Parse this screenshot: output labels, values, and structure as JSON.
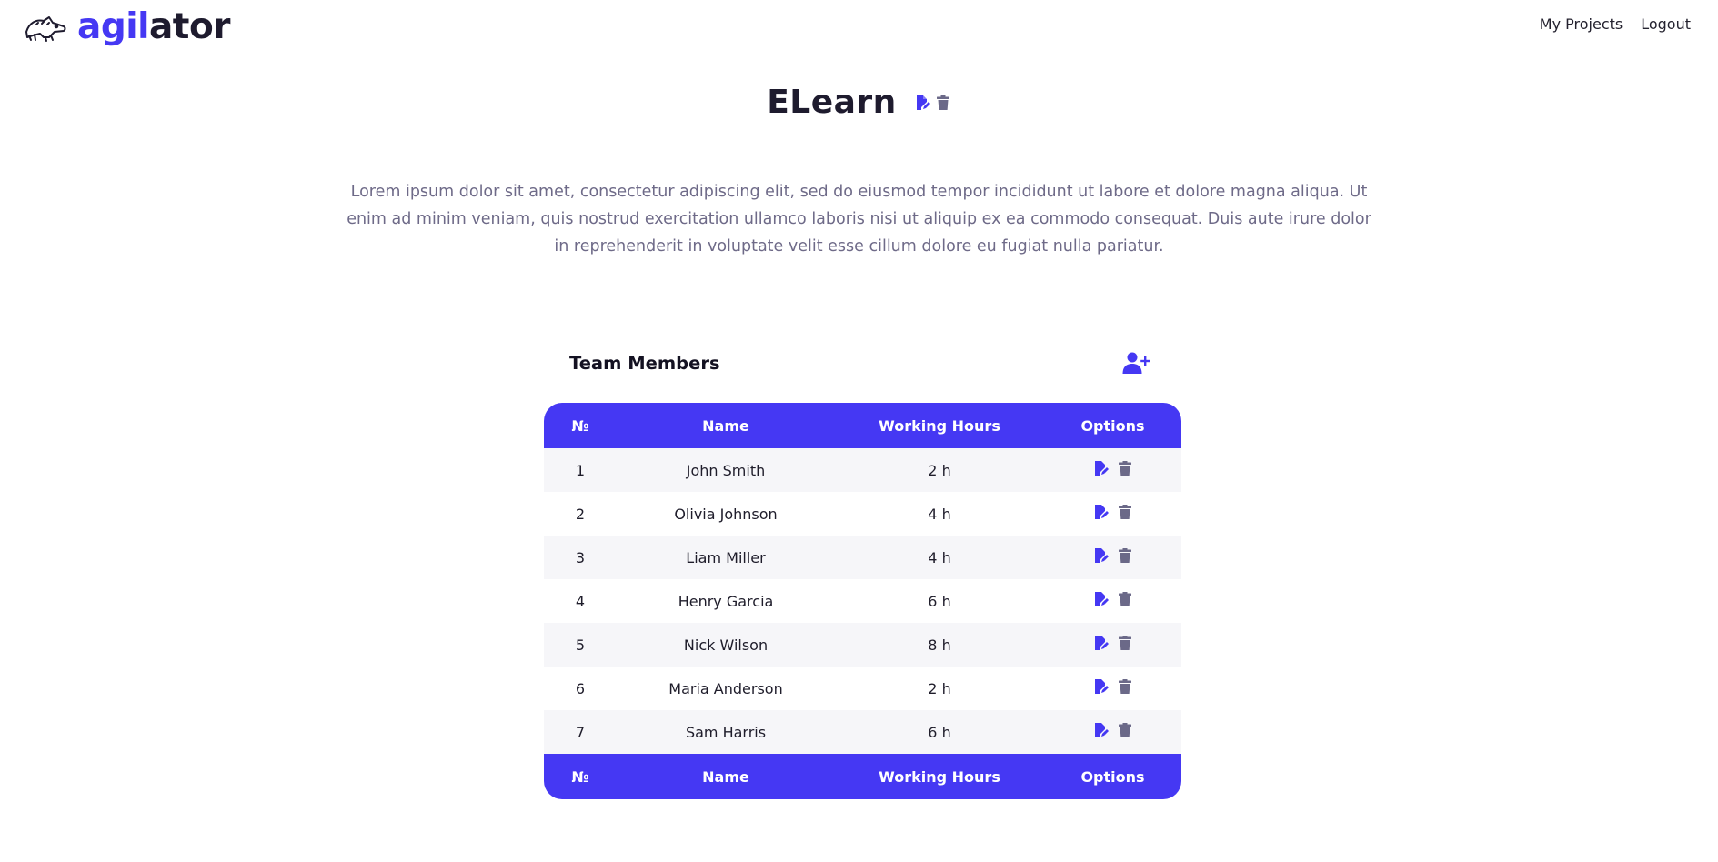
{
  "brand": {
    "accent_text": "agil",
    "rest_text": "ator",
    "icon": "crocodile-logo-icon"
  },
  "nav": {
    "my_projects": "My Projects",
    "logout": "Logout"
  },
  "project": {
    "title": "ELearn",
    "description": "Lorem ipsum dolor sit amet, consectetur adipiscing elit, sed do eiusmod tempor incididunt ut labore et dolore magna aliqua. Ut enim ad minim veniam, quis nostrud exercitation ullamco laboris nisi ut aliquip ex ea commodo consequat. Duis aute irure dolor in reprehenderit in voluptate velit esse cillum dolore eu fugiat nulla pariatur."
  },
  "team": {
    "title": "Team Members",
    "add_icon": "user-plus-icon",
    "columns": [
      "№",
      "Name",
      "Working Hours",
      "Options"
    ],
    "members": [
      {
        "num": "1",
        "name": "John Smith",
        "hours": "2 h"
      },
      {
        "num": "2",
        "name": "Olivia Johnson",
        "hours": "4 h"
      },
      {
        "num": "3",
        "name": "Liam Miller",
        "hours": "4 h"
      },
      {
        "num": "4",
        "name": "Henry Garcia",
        "hours": "6 h"
      },
      {
        "num": "5",
        "name": "Nick Wilson",
        "hours": "8 h"
      },
      {
        "num": "6",
        "name": "Maria Anderson",
        "hours": "2 h"
      },
      {
        "num": "7",
        "name": "Sam Harris",
        "hours": "6 h"
      }
    ]
  },
  "icons": {
    "edit": "edit-file-icon",
    "delete": "trash-icon"
  },
  "colors": {
    "accent": "#4538f3",
    "text_dark": "#1e1b2e",
    "muted": "#6e6a88",
    "trash": "#6b6988",
    "row_alt": "#f6f6f9"
  }
}
